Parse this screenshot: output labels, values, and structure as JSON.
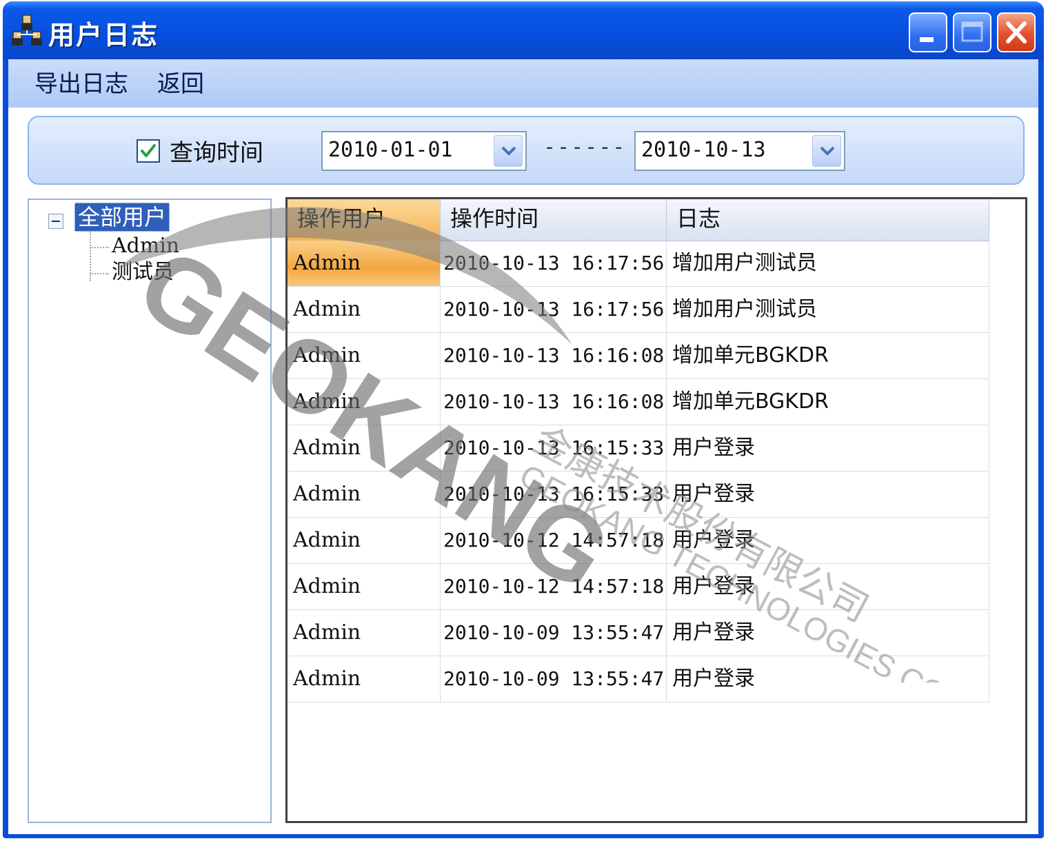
{
  "window": {
    "title": "用户日志"
  },
  "menu": [
    {
      "label": "导出日志"
    },
    {
      "label": "返回"
    }
  ],
  "filter": {
    "checkbox_label": "查询时间",
    "checked": true,
    "date_from": "2010-01-01",
    "separator": "------",
    "date_to": "2010-10-13"
  },
  "tree": {
    "root": "全部用户",
    "children": [
      "Admin",
      "测试员"
    ]
  },
  "grid": {
    "columns": [
      "操作用户",
      "操作时间",
      "日志"
    ],
    "rows": [
      {
        "user": "Admin",
        "time": "2010-10-13 16:17:56",
        "log": "增加用户测试员"
      },
      {
        "user": "Admin",
        "time": "2010-10-13 16:17:56",
        "log": "增加用户测试员"
      },
      {
        "user": "Admin",
        "time": "2010-10-13 16:16:08",
        "log": "增加单元BGKDR"
      },
      {
        "user": "Admin",
        "time": "2010-10-13 16:16:08",
        "log": "增加单元BGKDR"
      },
      {
        "user": "Admin",
        "time": "2010-10-13 16:15:33",
        "log": "用户登录"
      },
      {
        "user": "Admin",
        "time": "2010-10-13 16:15:33",
        "log": "用户登录"
      },
      {
        "user": "Admin",
        "time": "2010-10-12 14:57:18",
        "log": "用户登录"
      },
      {
        "user": "Admin",
        "time": "2010-10-12 14:57:18",
        "log": "用户登录"
      },
      {
        "user": "Admin",
        "time": "2010-10-09 13:55:47",
        "log": "用户登录"
      },
      {
        "user": "Admin",
        "time": "2010-10-09 13:55:47",
        "log": "用户登录"
      }
    ]
  },
  "watermark": {
    "logo_text": "GEOKANG",
    "company_cn": "金康技术股份有限公司",
    "company_en": "GEOKANG TECHNOLOGIES CO., LTD."
  },
  "icons": {
    "app": "users-tree-icon",
    "minimize": "minimize-icon",
    "maximize": "maximize-icon",
    "close": "close-icon",
    "dropdown": "chevron-down-icon",
    "check": "check-icon",
    "collapse": "minus-box-icon"
  },
  "colors": {
    "titlebar": "#0750e0",
    "menubar": "#c1d6fa",
    "selection": "#2f5fb9",
    "row_highlight": "#f4a640"
  }
}
